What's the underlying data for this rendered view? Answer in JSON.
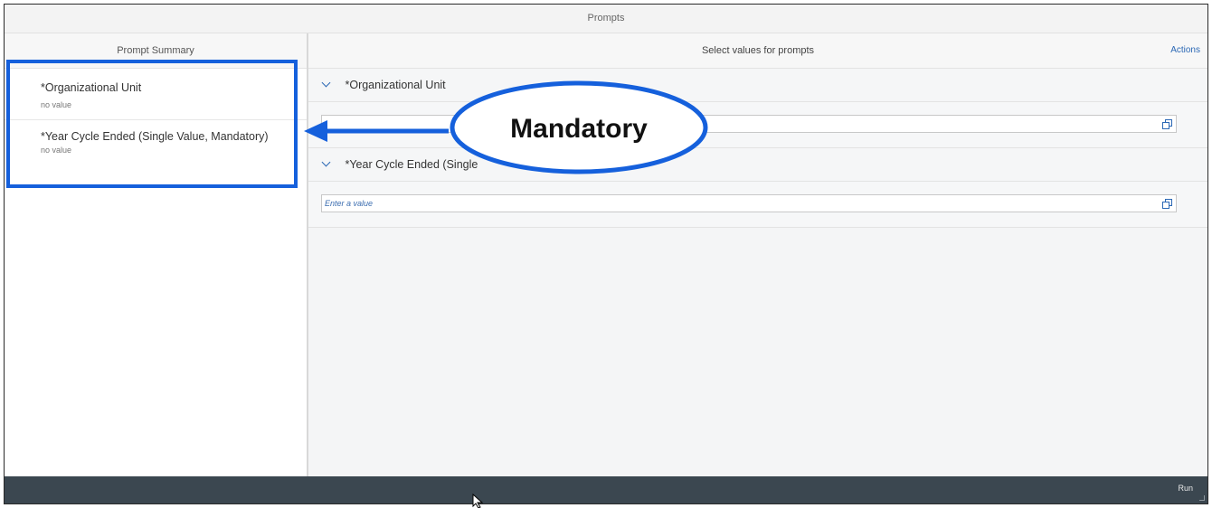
{
  "window": {
    "title": "Prompts"
  },
  "summary": {
    "header": "Prompt Summary",
    "items": [
      {
        "name": "*Organizational Unit",
        "value": "no value"
      },
      {
        "name": "*Year Cycle Ended (Single Value, Mandatory)",
        "value": "no value"
      }
    ]
  },
  "main": {
    "header": "Select values for prompts",
    "actions_label": "Actions",
    "sections": [
      {
        "title": "*Organizational Unit",
        "input_placeholder": ""
      },
      {
        "title": "*Year Cycle Ended (Single",
        "input_placeholder": "Enter a value"
      }
    ]
  },
  "footer": {
    "run_label": "Run"
  },
  "annotation": {
    "label": "Mandatory",
    "color": "#1560dc"
  },
  "colors": {
    "accent": "#2b68b5",
    "footer_bg": "#3b4750"
  }
}
